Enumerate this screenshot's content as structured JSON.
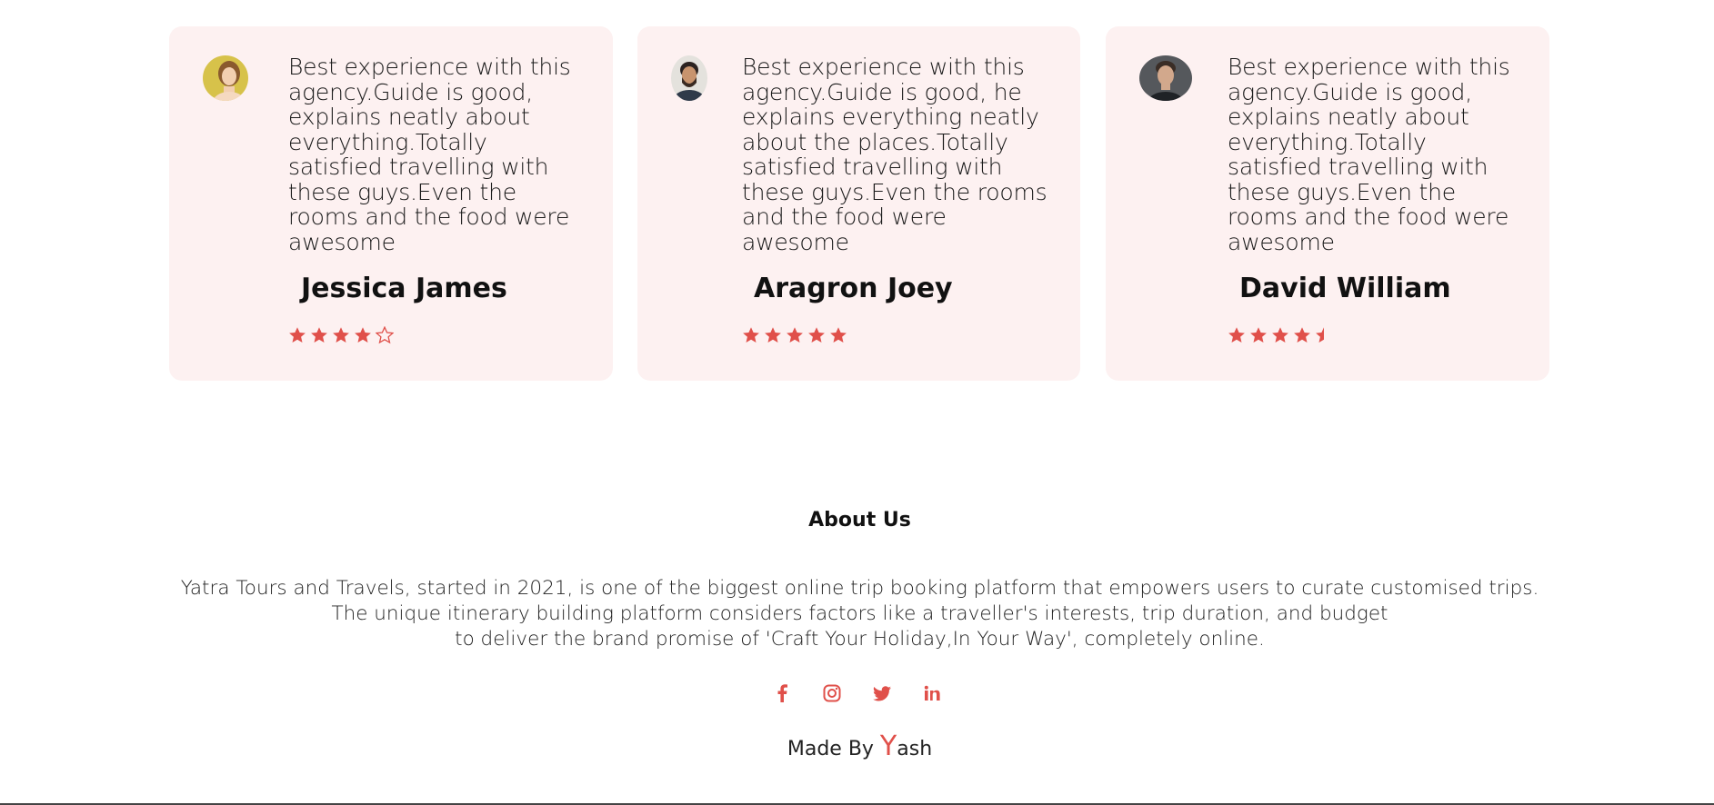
{
  "testimonials": [
    {
      "review_lines": [
        "Best experience with this",
        "agency.Guide is good,",
        "explains neatly about",
        "everything.Totally",
        "satisfied travelling with",
        "these guys.Even the",
        "rooms and the food were",
        "awesome"
      ],
      "name": "Jessica James",
      "rating": 4,
      "rating_max": 5,
      "avatar": "woman-portrait"
    },
    {
      "review_lines": [
        "Best experience with this",
        "agency.Guide is good, he",
        "explains everything neatly",
        "about the places.Totally",
        "satisfied travelling with",
        "these guys.Even the rooms",
        "and the food were",
        "awesome"
      ],
      "name": "Aragron Joey",
      "rating": 5,
      "rating_max": 5,
      "avatar": "bearded-man-portrait"
    },
    {
      "review_lines": [
        "Best experience with this",
        "agency.Guide is good,",
        "explains neatly about",
        "everything.Totally",
        "satisfied travelling with",
        "these guys.Even the",
        "rooms and the food were",
        "awesome"
      ],
      "name": "David William",
      "rating": 4.5,
      "rating_max": 5,
      "avatar": "man-portrait"
    }
  ],
  "about": {
    "title": "About Us",
    "lines": [
      "Yatra Tours and Travels, started in 2021, is one of the biggest online trip booking platform that empowers users to curate customised trips.",
      "The unique itinerary building platform considers factors like a traveller's interests, trip duration, and budget",
      "to deliver the brand promise of 'Craft Your Holiday,In Your Way', completely online."
    ]
  },
  "social": [
    "facebook-icon",
    "instagram-icon",
    "twitter-icon",
    "linkedin-icon"
  ],
  "footer": {
    "made_by": "Made By ",
    "author_initial": "Y",
    "author_rest": "ash"
  },
  "colors": {
    "accent": "#e0504a",
    "card_bg": "#fdf1f1"
  }
}
